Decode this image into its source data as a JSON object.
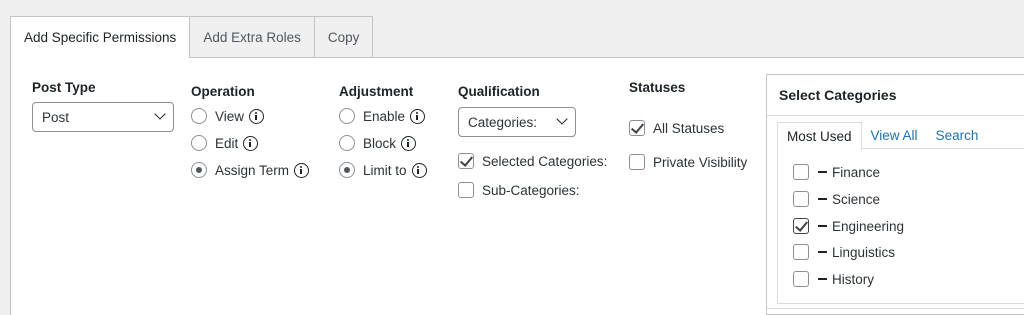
{
  "tabs": [
    {
      "label": "Add Specific Permissions",
      "active": true
    },
    {
      "label": "Add Extra Roles",
      "active": false
    },
    {
      "label": "Copy",
      "active": false
    }
  ],
  "post_type": {
    "title": "Post Type",
    "value": "Post"
  },
  "operation": {
    "title": "Operation",
    "options": [
      {
        "label": "View",
        "selected": false
      },
      {
        "label": "Edit",
        "selected": false
      },
      {
        "label": "Assign Term",
        "selected": true
      }
    ]
  },
  "adjustment": {
    "title": "Adjustment",
    "options": [
      {
        "label": "Enable",
        "selected": false
      },
      {
        "label": "Block",
        "selected": false
      },
      {
        "label": "Limit to",
        "selected": true
      }
    ]
  },
  "qualification": {
    "title": "Qualification",
    "select_value": "Categories:",
    "options": [
      {
        "label": "Selected Categories:",
        "checked": true
      },
      {
        "label": "Sub-Categories:",
        "checked": false
      }
    ]
  },
  "statuses": {
    "title": "Statuses",
    "options": [
      {
        "label": "All Statuses",
        "checked": true
      },
      {
        "label": "Private Visibility",
        "checked": false
      }
    ]
  },
  "categories": {
    "title": "Select Categories",
    "tabs": [
      {
        "label": "Most Used",
        "active": true
      },
      {
        "label": "View All",
        "active": false
      },
      {
        "label": "Search",
        "active": false
      }
    ],
    "items": [
      {
        "label": "Finance",
        "checked": false
      },
      {
        "label": "Science",
        "checked": false
      },
      {
        "label": "Engineering",
        "checked": true
      },
      {
        "label": "Linguistics",
        "checked": false
      },
      {
        "label": "History",
        "checked": false
      }
    ]
  }
}
